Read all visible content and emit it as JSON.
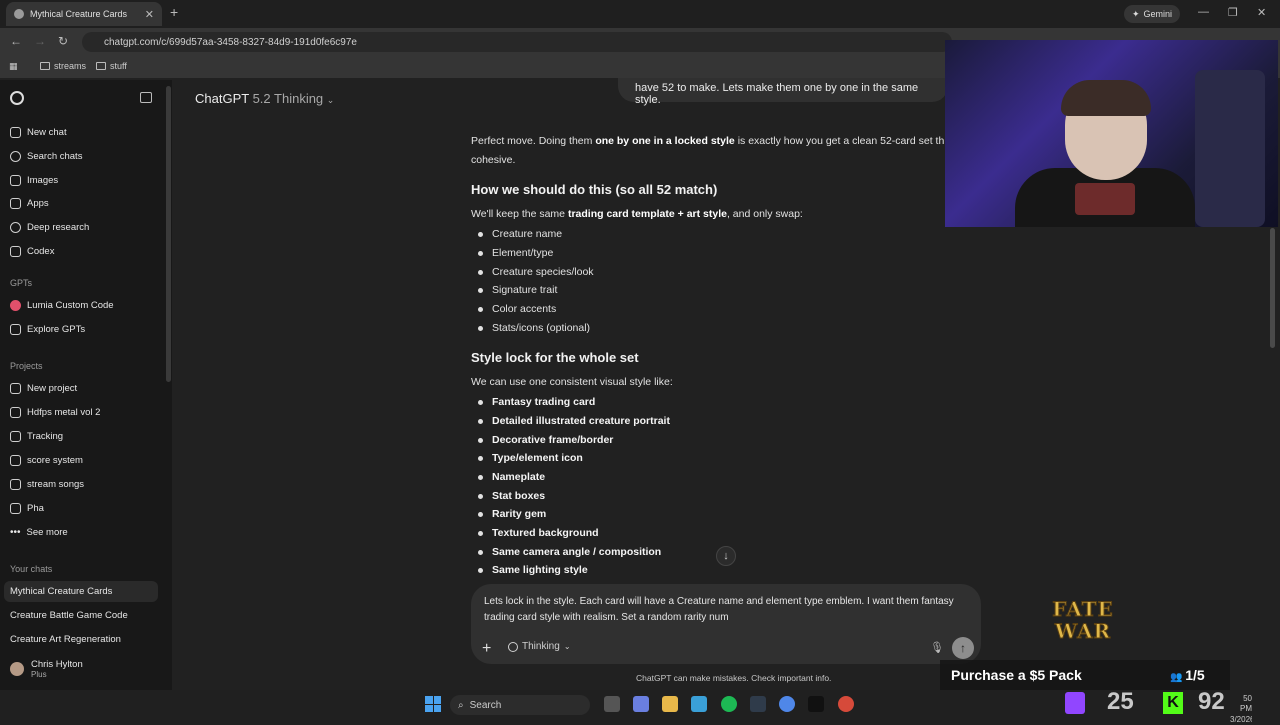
{
  "browser": {
    "tab_title": "Mythical Creature Cards",
    "url": "chatgpt.com/c/699d57aa-3458-8327-84d9-191d0fe6c97e",
    "gemini_label": "Gemini",
    "bookmarks": [
      "streams",
      "stuff"
    ]
  },
  "sidebar": {
    "nav": [
      "New chat",
      "Search chats",
      "Images",
      "Apps",
      "Deep research",
      "Codex"
    ],
    "gpts_heading": "GPTs",
    "gpts": [
      "Lumia Custom Code",
      "Explore GPTs"
    ],
    "projects_heading": "Projects",
    "projects": [
      "New project",
      "Hdfps metal vol 2",
      "Tracking",
      "score system",
      "stream songs",
      "Pha",
      "See more"
    ],
    "chats_heading": "Your chats",
    "chats": [
      "Mythical Creature Cards",
      "Creature Battle Game Code",
      "Creature Art Regeneration"
    ],
    "user": {
      "name": "Chris Hylton",
      "plan": "Plus"
    }
  },
  "header": {
    "model": "ChatGPT",
    "version": "5.2 Thinking"
  },
  "conversation": {
    "user_message": "have 52 to make. Lets make them one by one in the same style.",
    "intro_a": "Perfect move. Doing them ",
    "intro_b": "one by one in a locked style",
    "intro_c": " is exactly how you get a clean 52-card set th",
    "intro_line2": "cohesive.",
    "h1": "How we should do this (so all 52 match)",
    "p1_a": "We'll keep the same ",
    "p1_b": "trading card template + art style",
    "p1_c": ", and only swap:",
    "list1": [
      "Creature name",
      "Element/type",
      "Creature species/look",
      "Signature trait",
      "Color accents",
      "Stats/icons (optional)"
    ],
    "h2": "Style lock for the whole set",
    "p2": "We can use one consistent visual style like:",
    "list2": [
      "Fantasy trading card",
      "Detailed illustrated creature portrait",
      "Decorative frame/border",
      "Type/element icon",
      "Nameplate",
      "Stat boxes",
      "Rarity gem",
      "Textured background",
      "Same camera angle / composition",
      "Same lighting style"
    ]
  },
  "composer": {
    "text": "Lets lock in the style. Each card will have a Creature name and element type emblem. I want them fantasy trading card style with realism. Set a random rarity num",
    "mode": "Thinking"
  },
  "disclaimer": "ChatGPT can make mistakes. Check important info.",
  "overlay": {
    "logo_line1": "FATE",
    "logo_line2": "WAR",
    "promo": "Purchase a $5 Pack",
    "count": "1/5",
    "stat_twitch": "25",
    "stat_kick": "92"
  },
  "taskbar": {
    "search": "Search",
    "time": "50 PM",
    "date": "3/2026"
  }
}
